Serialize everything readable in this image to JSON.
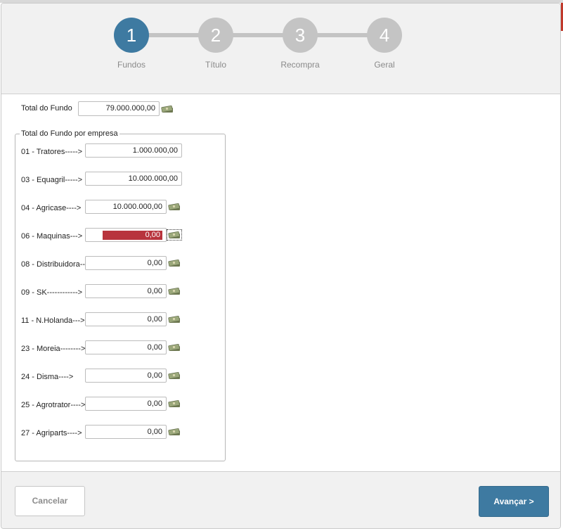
{
  "wizard": {
    "steps": [
      {
        "number": "1",
        "label": "Fundos"
      },
      {
        "number": "2",
        "label": "Título"
      },
      {
        "number": "3",
        "label": "Recompra"
      },
      {
        "number": "4",
        "label": "Geral"
      }
    ],
    "active_color": "#3e7aa1",
    "inactive_color": "#c4c4c4"
  },
  "total": {
    "label": "Total do Fundo",
    "value": "79.000.000,00"
  },
  "group": {
    "legend": "Total do Fundo por empresa",
    "rows": [
      {
        "label": "01 - Tratores----->",
        "value": "1.000.000,00"
      },
      {
        "label": "03 - Equagril----->",
        "value": "10.000.000,00"
      },
      {
        "label": "04 - Agricase---->",
        "value": "10.000.000,00"
      },
      {
        "label": "06 - Maquinas--->",
        "value": "0,00"
      },
      {
        "label": "08 - Distribuidora--",
        "value": "0,00"
      },
      {
        "label": "09 - SK------------>",
        "value": "0,00"
      },
      {
        "label": "11 - N.Holanda--->",
        "value": "0,00"
      },
      {
        "label": "23 - Moreia-------->",
        "value": "0,00"
      },
      {
        "label": "24 - Disma---->",
        "value": "0,00"
      },
      {
        "label": "25 - Agrotrator---->",
        "value": "0,00"
      },
      {
        "label": "27 - Agriparts---->",
        "value": "0,00"
      }
    ]
  },
  "footer": {
    "cancel_label": "Cancelar",
    "next_label": "Avançar >"
  },
  "icons": {
    "money": "money-icon"
  },
  "colors": {
    "accent": "#3e7aa1",
    "selection": "#b8343d"
  }
}
